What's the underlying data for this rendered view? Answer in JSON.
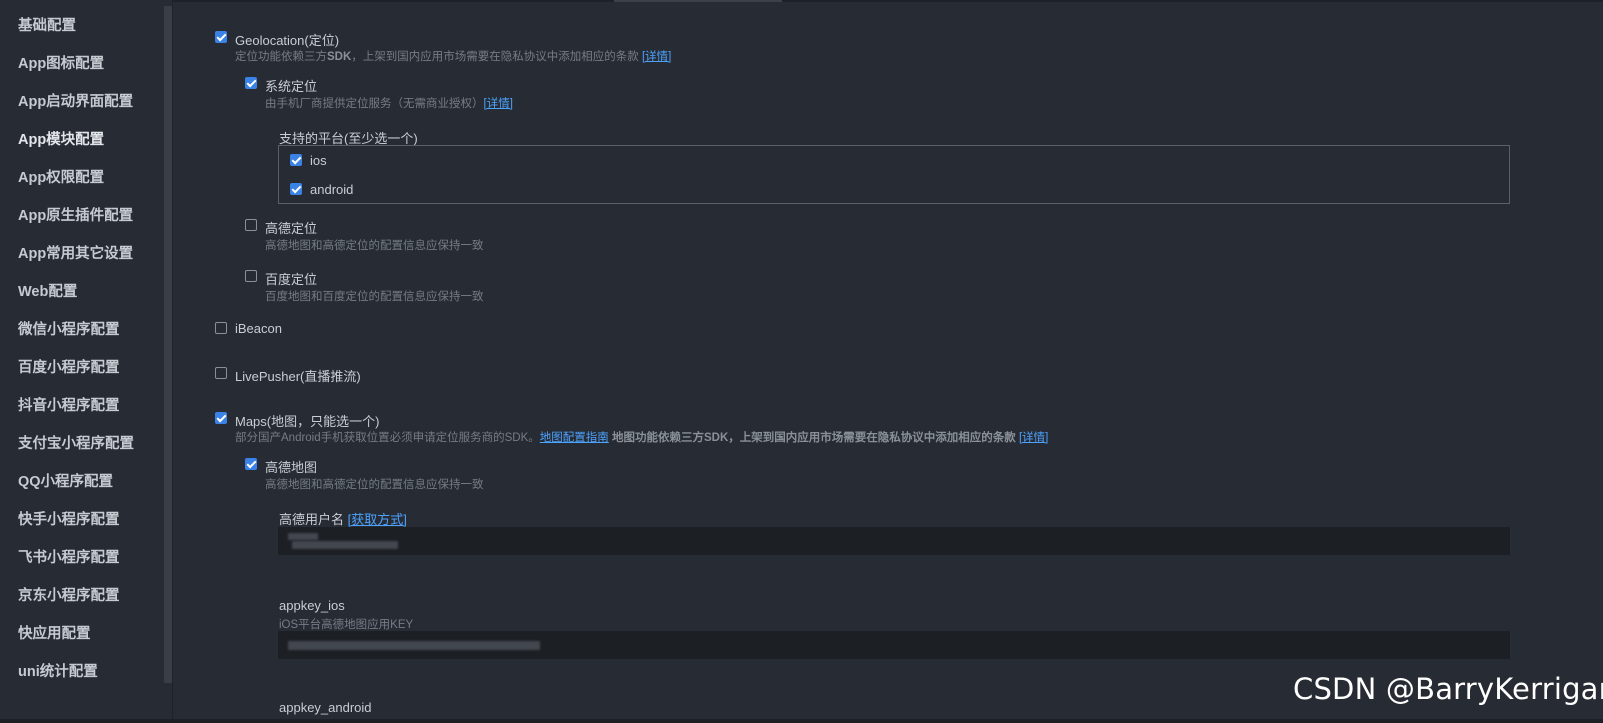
{
  "sidebar": {
    "items": [
      {
        "label": "基础配置"
      },
      {
        "label": "App图标配置"
      },
      {
        "label": "App启动界面配置"
      },
      {
        "label": "App模块配置"
      },
      {
        "label": "App权限配置"
      },
      {
        "label": "App原生插件配置"
      },
      {
        "label": "App常用其它设置"
      },
      {
        "label": "Web配置"
      },
      {
        "label": "微信小程序配置"
      },
      {
        "label": "百度小程序配置"
      },
      {
        "label": "抖音小程序配置"
      },
      {
        "label": "支付宝小程序配置"
      },
      {
        "label": "QQ小程序配置"
      },
      {
        "label": "快手小程序配置"
      },
      {
        "label": "飞书小程序配置"
      },
      {
        "label": "京东小程序配置"
      },
      {
        "label": "快应用配置"
      },
      {
        "label": "uni统计配置"
      }
    ],
    "active_index": 3
  },
  "modules": {
    "geolocation": {
      "label": "Geolocation(定位)",
      "checked": true,
      "desc_prefix": "定位功能依赖三方",
      "desc_sdk": "SDK",
      "desc_rest": "，上架到国内应用市场需要在隐私协议中添加相应的条款",
      "detail_link": "[详情]"
    },
    "system_location": {
      "label": "系统定位",
      "checked": true,
      "desc": "由手机厂商提供定位服务（无需商业授权）",
      "detail_link": "[详情]"
    },
    "platforms": {
      "title": "支持的平台(至少选一个)",
      "options": [
        {
          "label": "ios",
          "checked": true
        },
        {
          "label": "android",
          "checked": true
        }
      ]
    },
    "amap_location": {
      "label": "高德定位",
      "checked": false,
      "desc": "高德地图和高德定位的配置信息应保持一致"
    },
    "baidu_location": {
      "label": "百度定位",
      "checked": false,
      "desc": "百度地图和百度定位的配置信息应保持一致"
    },
    "ibeacon": {
      "label": "iBeacon",
      "checked": false
    },
    "livepusher": {
      "label": "LivePusher(直播推流)",
      "checked": false
    },
    "maps": {
      "label": "Maps(地图，只能选一个)",
      "checked": true,
      "desc_prefix": "部分国产Android手机获取位置必须申请定位服务商的SDK。",
      "guide_link": "地图配置指南",
      "desc_bold": " 地图功能依赖三方SDK，上架到国内应用市场需要在隐私协议中添加相应的条款",
      "detail_link": "[详情]"
    },
    "amap": {
      "label": "高德地图",
      "checked": true,
      "desc": "高德地图和高德定位的配置信息应保持一致",
      "username_label": "高德用户名",
      "username_link": "[获取方式]",
      "appkey_ios_label": "appkey_ios",
      "appkey_ios_desc": "iOS平台高德地图应用KEY",
      "appkey_android_label": "appkey_android"
    }
  },
  "colors": {
    "background": "#272b33",
    "accent": "#3b82e6",
    "link": "#4da3ff",
    "input_bg": "#1c1f24"
  },
  "watermark": "CSDN @BarryKerrigan"
}
